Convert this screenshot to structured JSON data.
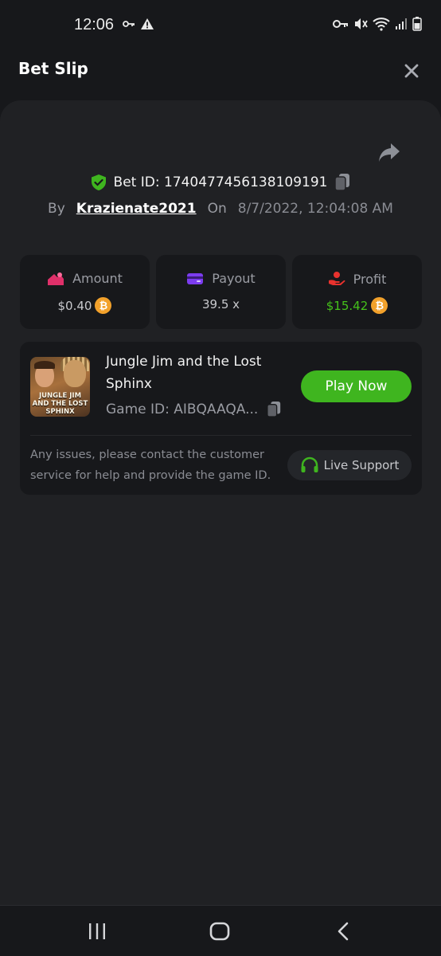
{
  "status_bar": {
    "time": "12:06",
    "left_icons": [
      "vpn-key-icon",
      "warning-icon"
    ],
    "right_icons": [
      "key-icon",
      "mute-vibrate-icon",
      "wifi-icon",
      "signal-icon",
      "battery-icon"
    ]
  },
  "header": {
    "title": "Bet Slip",
    "close_icon": "close-icon"
  },
  "bet": {
    "id_label": "Bet ID: 1740477456138109191",
    "by_label": "By",
    "username": "Krazienate2021",
    "on_label": "On",
    "date": "8/7/2022, 12:04:08 AM"
  },
  "stats": [
    {
      "label": "Amount",
      "value": "$0.40",
      "icon": "amount-icon",
      "coin": true,
      "color": "#c8c9cd"
    },
    {
      "label": "Payout",
      "value": "39.5 x",
      "icon": "payout-card-icon",
      "coin": false,
      "color": "#c8c9cd"
    },
    {
      "label": "Profit",
      "value": "$15.42",
      "icon": "profit-hand-icon",
      "coin": true,
      "color": "#45c21b"
    }
  ],
  "game": {
    "name": "Jungle Jim and the Lost Sphinx",
    "thumb_text": "JUNGLE JIM AND THE LOST SPHINX",
    "id_label": "Game ID: AIBQAAQA...",
    "play_label": "Play Now",
    "issue_text": "Any issues, please contact the customer service for help and provide the game ID.",
    "support_label": "Live Support"
  },
  "colors": {
    "accent_green": "#3fb51f",
    "profit_green": "#45c21b",
    "coin_orange": "#f2a12b",
    "panel_bg": "#202124",
    "card_bg": "#17181b"
  },
  "coin_symbol": "₿"
}
